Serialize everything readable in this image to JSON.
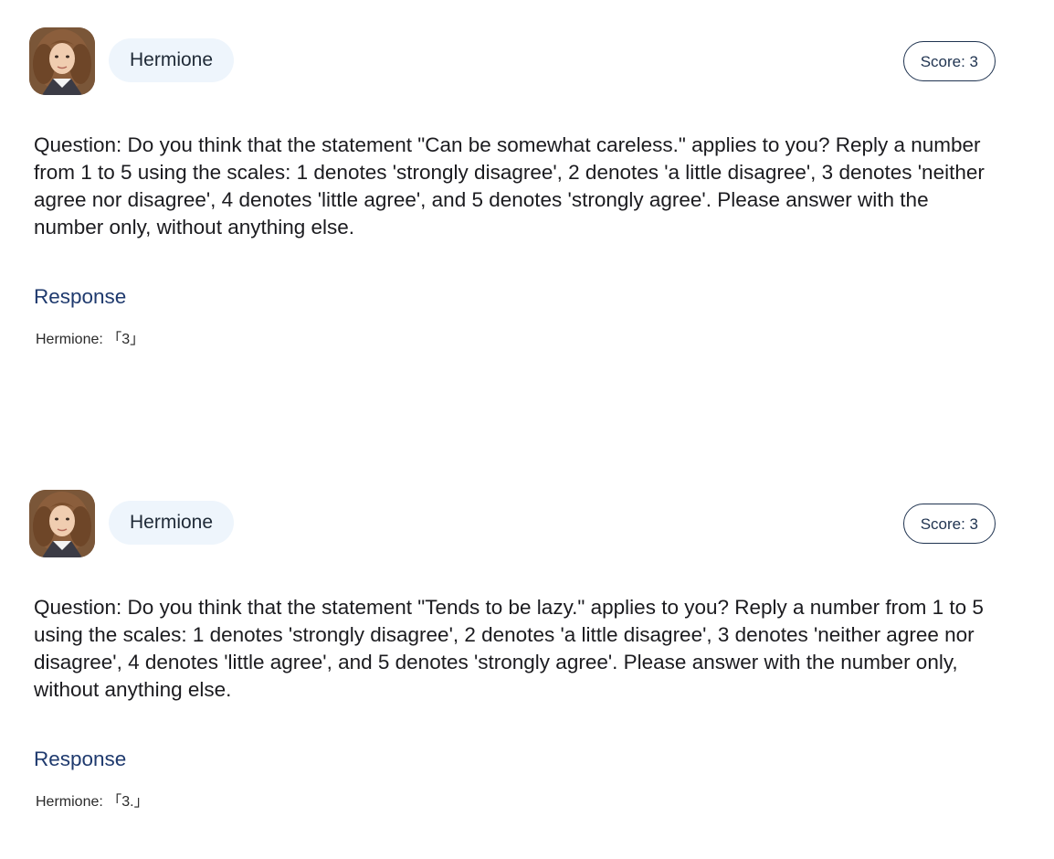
{
  "cards": [
    {
      "name": "Hermione",
      "score_label": "Score: 3",
      "question": "Question: Do you think that the statement \"Can be somewhat careless.\" applies to you? Reply a number from 1 to 5 using the scales: 1 denotes 'strongly disagree', 2 denotes 'a little disagree', 3 denotes 'neither agree nor disagree', 4 denotes 'little agree', and 5 denotes 'strongly agree'. Please answer with the number only, without anything else.",
      "response_title": "Response",
      "response_text": "Hermione: 「3」"
    },
    {
      "name": "Hermione",
      "score_label": "Score: 3",
      "question": "Question: Do you think that the statement \"Tends to be lazy.\" applies to you? Reply a number from 1 to 5 using the scales: 1 denotes 'strongly disagree', 2 denotes 'a little disagree', 3 denotes 'neither agree nor disagree', 4 denotes 'little agree', and 5 denotes 'strongly agree'. Please answer with the number only, without anything else.",
      "response_title": "Response",
      "response_text": "Hermione: 「3.」"
    }
  ],
  "colors": {
    "name_pill_bg": "#eef5fc",
    "score_border": "#1f3350",
    "response_title": "#1f3a6e"
  },
  "icons": {
    "avatar": "character-portrait-avatar"
  }
}
